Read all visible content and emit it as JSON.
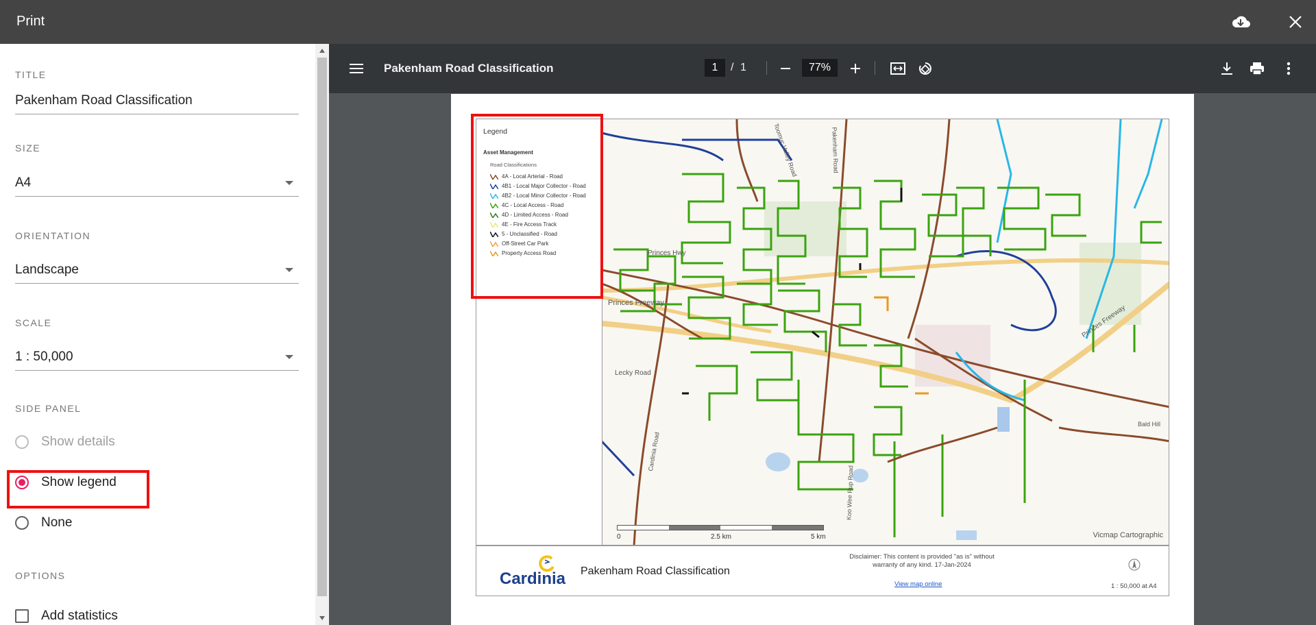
{
  "dialog": {
    "title": "Print"
  },
  "panel": {
    "title_label": "TITLE",
    "title_value": "Pakenham Road Classification",
    "size_label": "SIZE",
    "size_value": "A4",
    "orientation_label": "ORIENTATION",
    "orientation_value": "Landscape",
    "scale_label": "SCALE",
    "scale_value": "1 : 50,000",
    "side_panel_label": "SIDE PANEL",
    "side_panel_options": [
      "Show details",
      "Show legend",
      "None"
    ],
    "side_panel_selected": "Show legend",
    "options_label": "OPTIONS",
    "add_statistics": "Add statistics"
  },
  "viewer": {
    "doc_title": "Pakenham Road Classification",
    "page_current": "1",
    "page_sep": "/",
    "page_total": "1",
    "zoom": "77%"
  },
  "map": {
    "legend": {
      "title": "Legend",
      "group": "Asset Management",
      "subgroup": "Road Classifications",
      "items": [
        {
          "label": "4A - Local Arterial - Road",
          "color": "#8b4a2b"
        },
        {
          "label": "4B1 - Local Major Collector - Road",
          "color": "#1f3f9a"
        },
        {
          "label": "4B2 - Local Minor Collector - Road",
          "color": "#27b7e8"
        },
        {
          "label": "4C - Local Access - Road",
          "color": "#3aa30f"
        },
        {
          "label": "4D - Limited Access - Road",
          "color": "#2f7d1a"
        },
        {
          "label": "4E - Fire Access Track",
          "color": "#e8e870"
        },
        {
          "label": "5 - Unclassified - Road",
          "color": "#111111"
        },
        {
          "label": "Off-Street Car Park",
          "color": "#f2a13a"
        },
        {
          "label": "Property Access Road",
          "color": "#e89a1c"
        }
      ]
    },
    "scalebar": {
      "left": "0",
      "mid": "2.5 km",
      "right": "5 km"
    },
    "attribution": "Vicmap Cartographic",
    "place_labels": [
      "Princes Hwy",
      "Princes Freeway",
      "Lecky Road",
      "Cardinia Road",
      "Pakenham Road",
      "Toomuc Valley Road",
      "Koo Wee Rup Road",
      "Princes Freeway",
      "Bald Hill"
    ]
  },
  "footer": {
    "logo": "Cardinia",
    "title": "Pakenham Road Classification",
    "disclaimer": "Disclaimer: This content is provided \"as is\" without warranty of any kind. 17-Jan-2024",
    "link": "View map online",
    "scale": "1 : 50,000 at A4"
  }
}
